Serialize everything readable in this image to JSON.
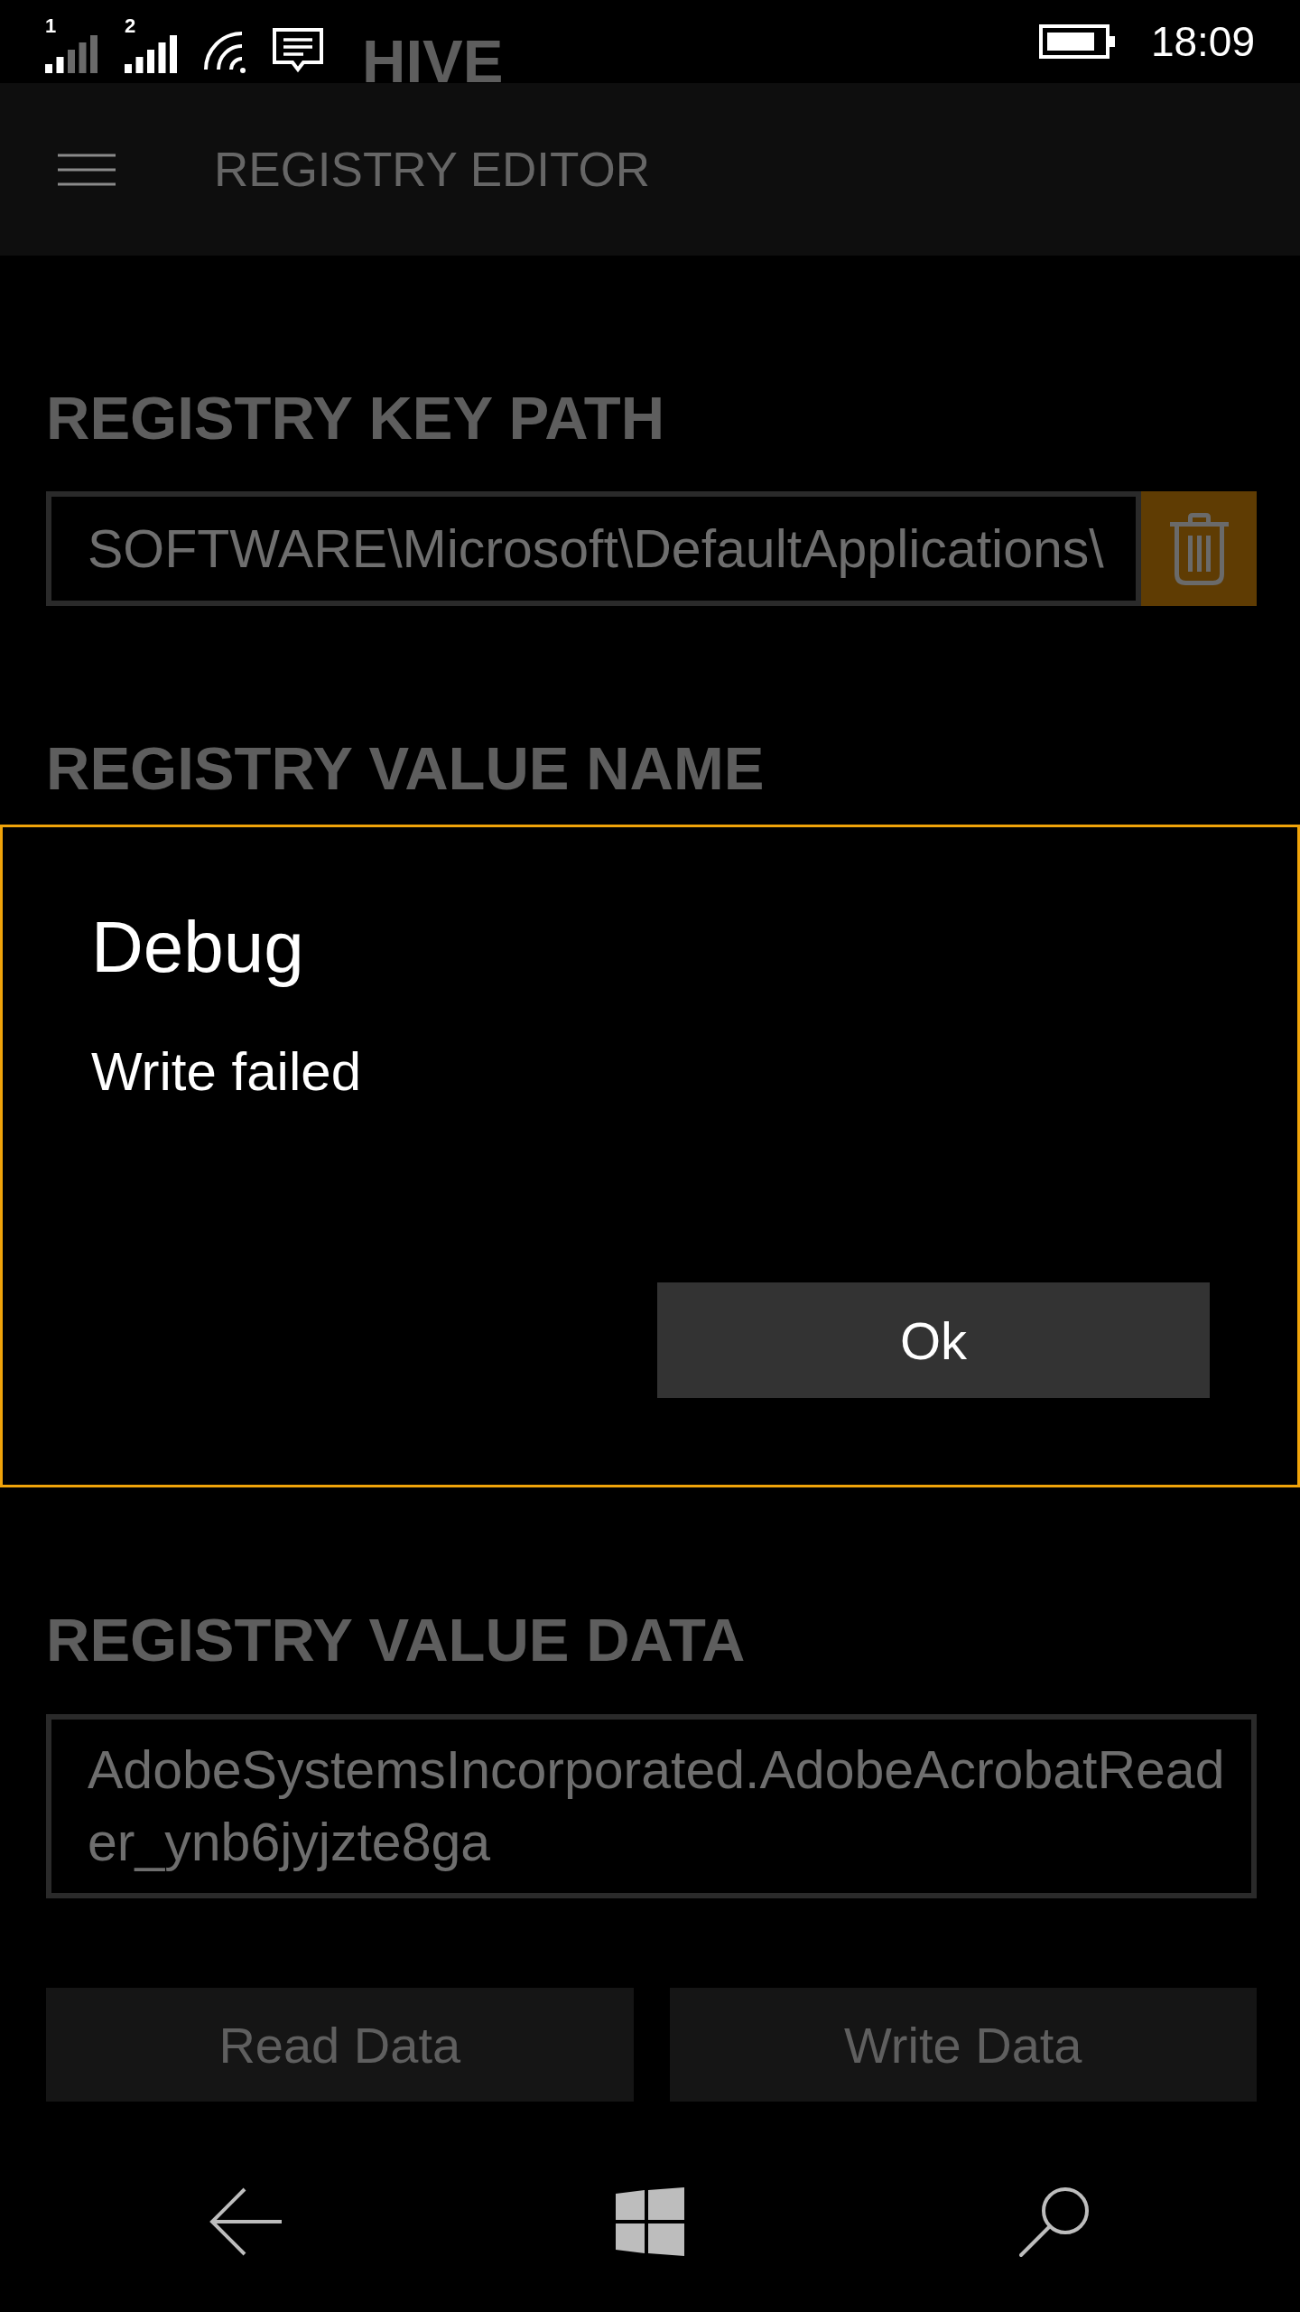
{
  "status_bar": {
    "signals": [
      {
        "kind": "weak",
        "sim": "1"
      },
      {
        "kind": "full",
        "sim": "2"
      }
    ],
    "time": "18:09"
  },
  "hive": {
    "label": "HIVE"
  },
  "app_bar": {
    "title": "REGISTRY EDITOR"
  },
  "key_path": {
    "label": "REGISTRY KEY PATH",
    "value": "SOFTWARE\\Microsoft\\DefaultApplications\\"
  },
  "value_name": {
    "label": "REGISTRY VALUE NAME"
  },
  "dialog": {
    "title": "Debug",
    "message": "Write failed",
    "button": "Ok"
  },
  "value_data": {
    "label": "REGISTRY VALUE DATA",
    "value": "AdobeSystemsIncorporated.AdobeAcrobatReader_ynb6jyjzte8ga"
  },
  "actions": [
    "Read Data",
    "Write Data"
  ]
}
